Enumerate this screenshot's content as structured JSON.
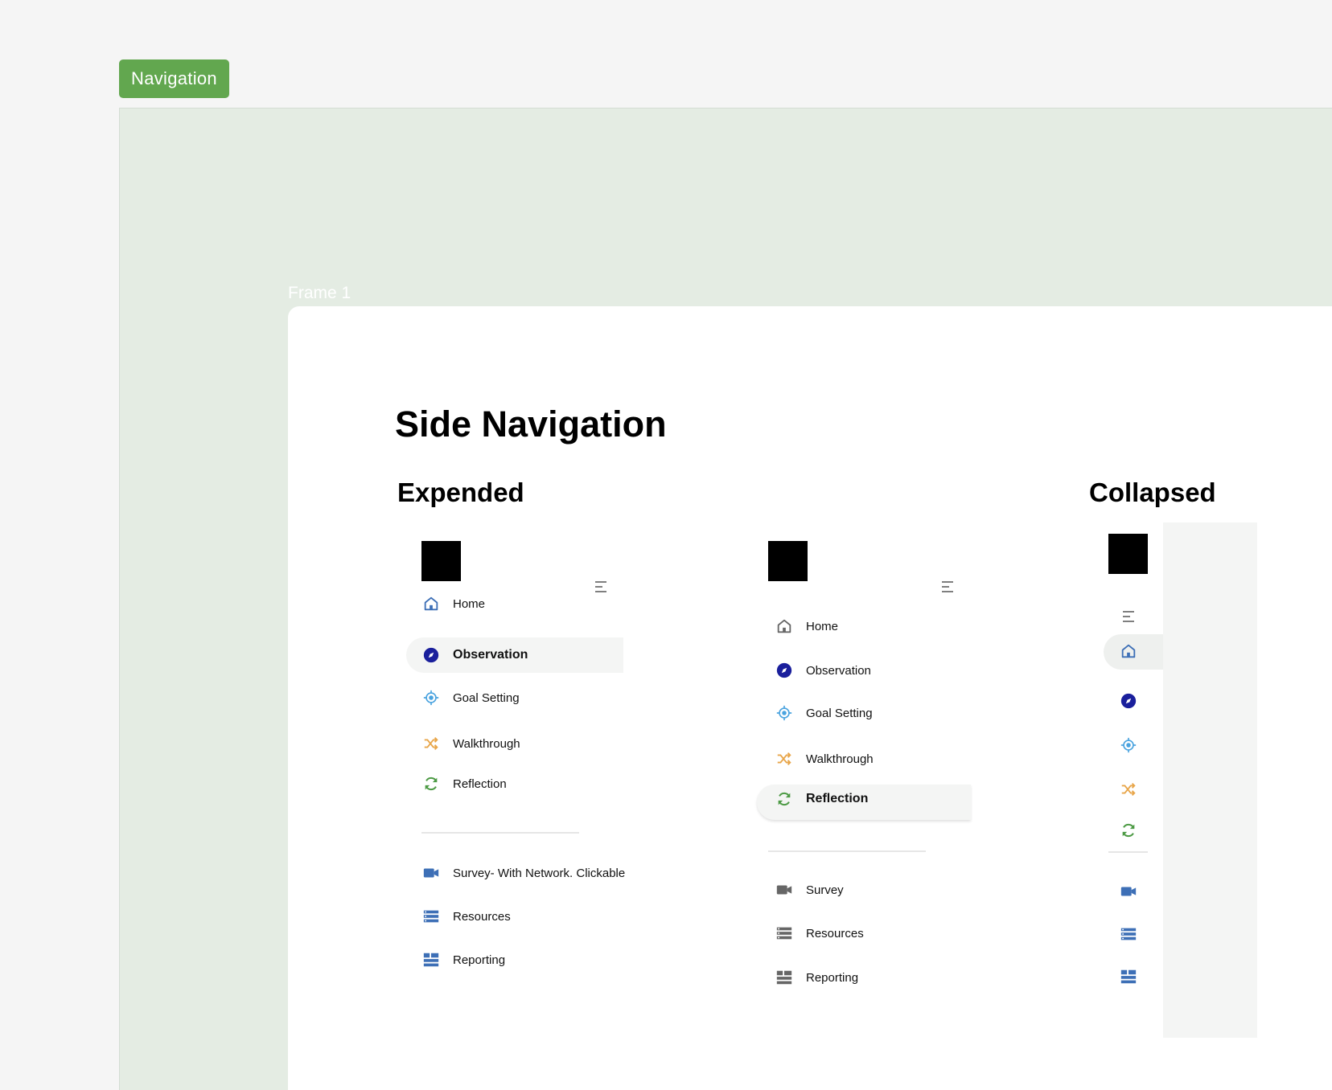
{
  "badge": {
    "label": "Navigation"
  },
  "frame": {
    "label": "Frame 1"
  },
  "page": {
    "title": "Side Navigation"
  },
  "expanded": {
    "heading": "Expended",
    "primary": [
      {
        "label": "Home",
        "icon": "home-icon"
      },
      {
        "label": "Observation",
        "icon": "compass-icon",
        "active": true
      },
      {
        "label": "Goal Setting",
        "icon": "target-icon"
      },
      {
        "label": "Walkthrough",
        "icon": "shuffle-icon"
      },
      {
        "label": "Reflection",
        "icon": "refresh-icon"
      }
    ],
    "secondary": [
      {
        "label": "Survey- With Network. Clickable",
        "icon": "video-icon"
      },
      {
        "label": "Resources",
        "icon": "list-icon"
      },
      {
        "label": "Reporting",
        "icon": "table-icon"
      }
    ]
  },
  "expanded_alt": {
    "primary": [
      {
        "label": "Home",
        "icon": "home-icon"
      },
      {
        "label": "Observation",
        "icon": "compass-icon"
      },
      {
        "label": "Goal Setting",
        "icon": "target-icon"
      },
      {
        "label": "Walkthrough",
        "icon": "shuffle-icon"
      },
      {
        "label": "Reflection",
        "icon": "refresh-icon",
        "active": true
      }
    ],
    "secondary": [
      {
        "label": "Survey",
        "icon": "video-icon"
      },
      {
        "label": "Resources",
        "icon": "list-icon"
      },
      {
        "label": "Reporting",
        "icon": "table-icon"
      }
    ]
  },
  "collapsed": {
    "heading": "Collapsed"
  },
  "colors": {
    "badge": "#62a74f",
    "section": "#e4ece3",
    "icon_blue": "#3d6fb6",
    "icon_navy": "#1a1f9c",
    "icon_light_blue": "#4aa3df",
    "icon_orange": "#e8a64a",
    "icon_green": "#4c9a44",
    "icon_gray": "#666666"
  }
}
